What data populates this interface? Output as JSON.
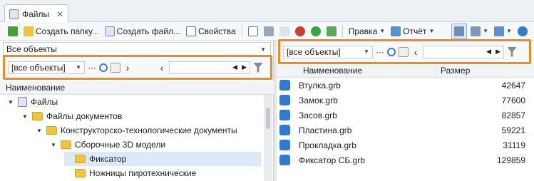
{
  "tab": {
    "label": "Файлы",
    "close": "✕"
  },
  "toolbar": {
    "create_folder": "Создать папку...",
    "create_file": "Создать файл...",
    "properties": "Свойства",
    "edit_menu": "Правка",
    "report_menu": "Отчёт"
  },
  "left": {
    "scope": "Все объекты",
    "filter_value": "[все объекты]",
    "ellipsis": "···",
    "column": "Наименование",
    "tree": [
      {
        "label": "Файлы",
        "expanded": true
      },
      {
        "label": "Файлы документов",
        "expanded": true
      },
      {
        "label": "Конструкторско-технологические документы",
        "expanded": true
      },
      {
        "label": "Сборочные 3D модели",
        "expanded": true
      },
      {
        "label": "Фиксатор",
        "selected": true
      },
      {
        "label": "Ножницы пиротехнические"
      }
    ]
  },
  "right": {
    "filter_value": "[все объекты]",
    "ellipsis": "···",
    "columns": {
      "name": "Наименование",
      "size": "Размер"
    },
    "files": [
      {
        "name": "Втулка.grb",
        "size": "42647"
      },
      {
        "name": "Замок.grb",
        "size": "77600"
      },
      {
        "name": "Засов.grb",
        "size": "82857"
      },
      {
        "name": "Пластина.grb",
        "size": "59221"
      },
      {
        "name": "Прокладка.grb",
        "size": "31119"
      },
      {
        "name": "Фиксатор СБ.grb",
        "size": "129859"
      }
    ]
  },
  "colors": {
    "highlight": "#f0891e",
    "selection": "#dbe9f9",
    "folder": "#f2c43a",
    "file_icon": "#2f7bd0"
  }
}
